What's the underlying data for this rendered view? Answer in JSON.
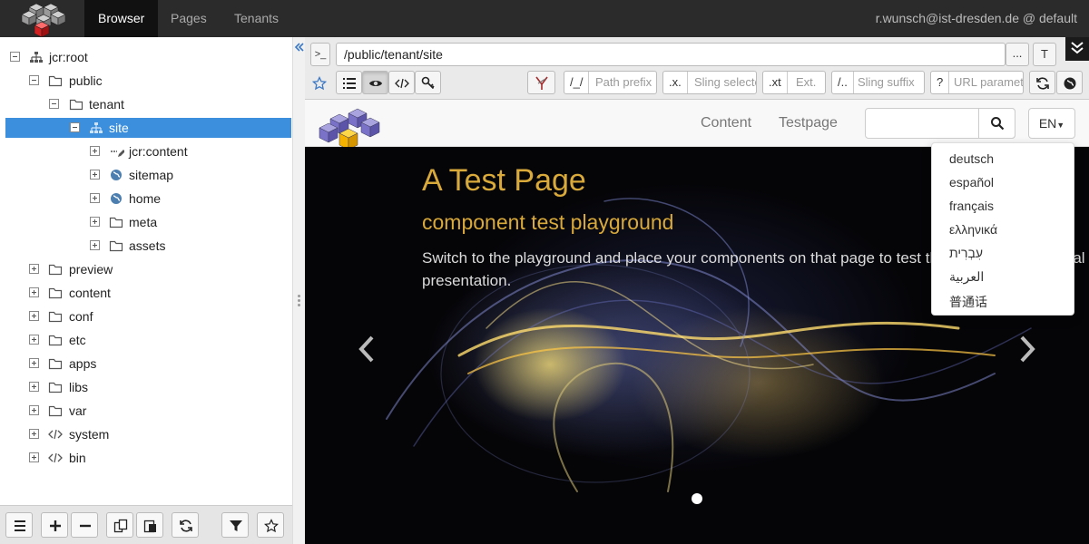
{
  "topbar": {
    "tabs": [
      {
        "label": "Browser",
        "active": true
      },
      {
        "label": "Pages",
        "active": false
      },
      {
        "label": "Tenants",
        "active": false
      }
    ],
    "user": "r.wunsch@ist-dresden.de @ default"
  },
  "tree": {
    "nodes": [
      {
        "label": "jcr:root",
        "icon": "sitemap-icon",
        "toggle": "minus"
      },
      {
        "label": "public",
        "icon": "folder-icon",
        "toggle": "minus"
      },
      {
        "label": "tenant",
        "icon": "folder-icon",
        "toggle": "minus"
      },
      {
        "label": "site",
        "icon": "sitemap-icon",
        "toggle": "minus",
        "selected": true
      },
      {
        "label": "jcr:content",
        "icon": "pencil-icon",
        "toggle": "plus"
      },
      {
        "label": "sitemap",
        "icon": "globe-icon",
        "toggle": "plus"
      },
      {
        "label": "home",
        "icon": "globe-icon",
        "toggle": "plus"
      },
      {
        "label": "meta",
        "icon": "folder-icon",
        "toggle": "plus"
      },
      {
        "label": "assets",
        "icon": "folder-icon",
        "toggle": "plus"
      },
      {
        "label": "preview",
        "icon": "folder-icon",
        "toggle": "plus"
      },
      {
        "label": "content",
        "icon": "folder-icon",
        "toggle": "plus"
      },
      {
        "label": "conf",
        "icon": "folder-icon",
        "toggle": "plus"
      },
      {
        "label": "etc",
        "icon": "folder-icon",
        "toggle": "plus"
      },
      {
        "label": "apps",
        "icon": "folder-icon",
        "toggle": "plus"
      },
      {
        "label": "libs",
        "icon": "folder-icon",
        "toggle": "plus"
      },
      {
        "label": "var",
        "icon": "folder-icon",
        "toggle": "plus"
      },
      {
        "label": "system",
        "icon": "code-icon",
        "toggle": "plus"
      },
      {
        "label": "bin",
        "icon": "code-icon",
        "toggle": "plus"
      }
    ]
  },
  "toolbar": {
    "path_value": "/public/tenant/site",
    "path_more": "...",
    "path_t": "T",
    "selectors": [
      {
        "prefix": "/_/",
        "placeholder": "Path prefix"
      },
      {
        "prefix": ".x.",
        "placeholder": "Sling selectors"
      },
      {
        "prefix": ".xt",
        "placeholder": "Ext."
      },
      {
        "prefix": "/..",
        "placeholder": "Sling suffix"
      },
      {
        "prefix": "?",
        "placeholder": "URL parameters"
      }
    ]
  },
  "site": {
    "nav": [
      "Content",
      "Testpage"
    ],
    "lang_button": "EN",
    "hero_title": "A Test Page",
    "hero_subtitle": "component test playground",
    "hero_text": "Switch to the playground and place your components on that page to test the editing and the final presentation.",
    "languages": [
      "deutsch",
      "español",
      "français",
      "ελληνικά",
      "עִבְרִית",
      "العربية",
      "普通话"
    ]
  },
  "colors": {
    "accent": "#3b8fdc",
    "hero_gold": "#d9a93a",
    "topbar": "#2b2b2b"
  }
}
